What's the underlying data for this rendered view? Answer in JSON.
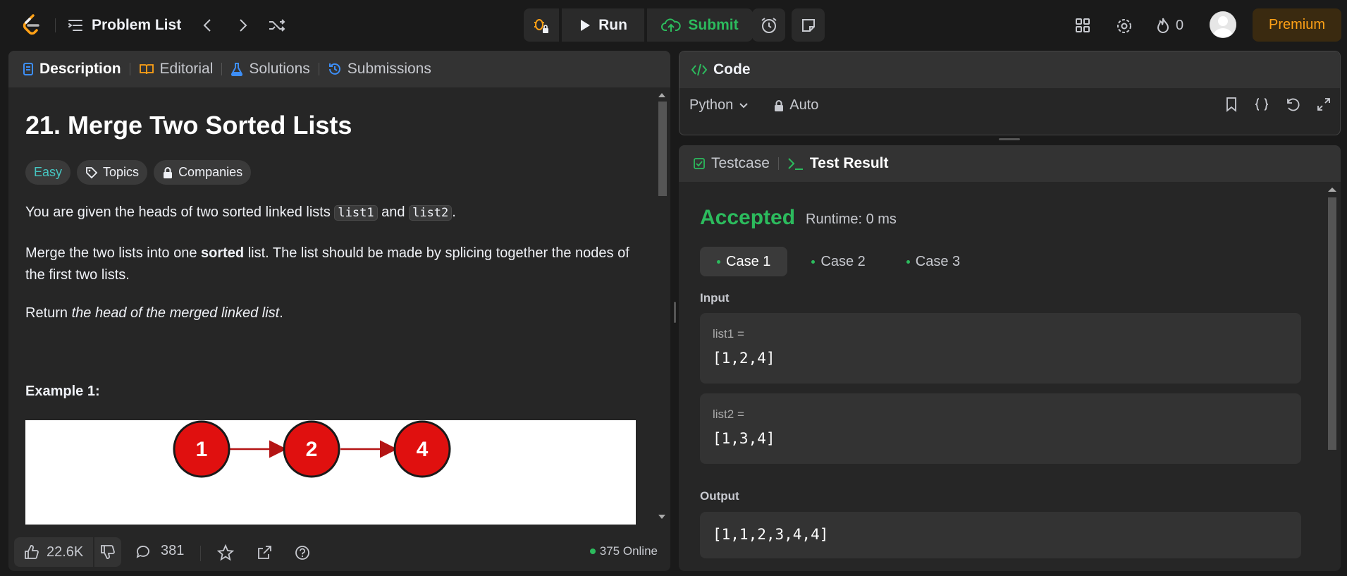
{
  "header": {
    "problem_list_label": "Problem List",
    "run_label": "Run",
    "submit_label": "Submit",
    "streak_count": "0",
    "premium_label": "Premium"
  },
  "description_tabs": [
    {
      "label": "Description"
    },
    {
      "label": "Editorial"
    },
    {
      "label": "Solutions"
    },
    {
      "label": "Submissions"
    }
  ],
  "problem": {
    "title": "21. Merge Two Sorted Lists",
    "difficulty": "Easy",
    "topics_label": "Topics",
    "companies_label": "Companies",
    "p1_a": "You are given the heads of two sorted linked lists ",
    "p1_code1": "list1",
    "p1_b": " and ",
    "p1_code2": "list2",
    "p1_c": ".",
    "p2_a": "Merge the two lists into one ",
    "p2_bold": "sorted",
    "p2_b": " list. The list should be made by splicing together the nodes of the first two lists.",
    "p3_a": "Return ",
    "p3_italic": "the head of the merged linked list",
    "p3_b": ".",
    "example_heading": "Example 1:",
    "diagram_nodes": [
      "1",
      "2",
      "4"
    ]
  },
  "footer": {
    "likes": "22.6K",
    "comments": "381",
    "online": "375 Online"
  },
  "code_panel": {
    "title": "Code",
    "language": "Python",
    "auto_label": "Auto"
  },
  "result_tabs": [
    {
      "label": "Testcase"
    },
    {
      "label": "Test Result"
    }
  ],
  "result": {
    "status": "Accepted",
    "runtime": "Runtime: 0 ms",
    "cases": [
      {
        "label": "Case 1"
      },
      {
        "label": "Case 2"
      },
      {
        "label": "Case 3"
      }
    ],
    "input_label": "Input",
    "inputs": [
      {
        "name": "list1 =",
        "value": "[1,2,4]"
      },
      {
        "name": "list2 =",
        "value": "[1,3,4]"
      }
    ],
    "output_label": "Output",
    "output_value": "[1,1,2,3,4,4]"
  },
  "colors": {
    "accent_green": "#2cbb5d",
    "easy_teal": "#46c6c2",
    "premium_orange": "#ffa116",
    "node_red": "#e0100f"
  }
}
